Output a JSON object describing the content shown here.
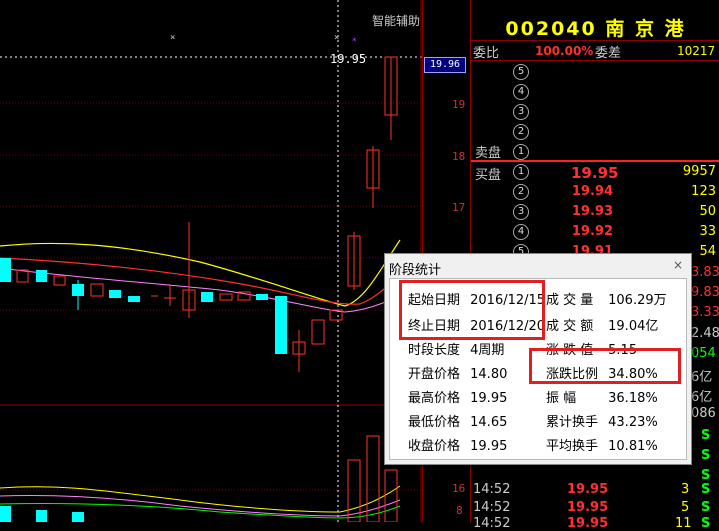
{
  "header": {
    "smart_assist": "智能辅助",
    "highlight_price": "19.95",
    "price_tag": "19.96"
  },
  "axis": {
    "labels": [
      "19",
      "18",
      "17"
    ],
    "low_labels": [
      "16",
      "8"
    ]
  },
  "panel": {
    "code": "002040",
    "name": "南 京 港",
    "weibi_label": "委比",
    "weibi_value": "100.00%",
    "weicha_label": "委差",
    "weicha_value": "10217",
    "sell_label": "卖盘",
    "buy_label": "买盘",
    "sell_levels": [
      "5",
      "4",
      "3",
      "2",
      "1"
    ],
    "buy_levels": [
      {
        "n": "1",
        "price": "19.95",
        "vol": "9957"
      },
      {
        "n": "2",
        "price": "19.94",
        "vol": "123"
      },
      {
        "n": "3",
        "price": "19.93",
        "vol": "50"
      },
      {
        "n": "4",
        "price": "19.92",
        "vol": "33"
      },
      {
        "n": "5",
        "price": "19.91",
        "vol": "54"
      }
    ],
    "side_values": [
      "3.83",
      "9.83",
      "3.33",
      "2.48",
      "054",
      "6亿",
      "6亿",
      "086"
    ],
    "trades": [
      {
        "time": "14:52",
        "price": "19.95",
        "vol": "3",
        "bs": "S"
      },
      {
        "time": "14:52",
        "price": "19.95",
        "vol": "5",
        "bs": "S"
      },
      {
        "time": "14:52",
        "price": "19.95",
        "vol": "11",
        "bs": "S"
      }
    ],
    "trade_s_col": [
      "S",
      "S",
      "S",
      "S"
    ]
  },
  "dialog": {
    "title": "阶段统计",
    "close": "×",
    "left": [
      {
        "k": "起始日期",
        "v": "2016/12/15"
      },
      {
        "k": "终止日期",
        "v": "2016/12/20"
      },
      {
        "k": "时段长度",
        "v": "4周期"
      },
      {
        "k": "开盘价格",
        "v": "14.80"
      },
      {
        "k": "最高价格",
        "v": "19.95"
      },
      {
        "k": "最低价格",
        "v": "14.65"
      },
      {
        "k": "收盘价格",
        "v": "19.95"
      }
    ],
    "right": [
      {
        "k": "成 交 量",
        "v": "106.29万"
      },
      {
        "k": "成 交 额",
        "v": "19.04亿"
      },
      {
        "k": "涨 跌 值",
        "v": "5.15"
      },
      {
        "k": "涨跌比例",
        "v": "34.80%"
      },
      {
        "k": "振 幅",
        "v": "36.18%"
      },
      {
        "k": "累计换手",
        "v": "43.23%"
      },
      {
        "k": "平均换手",
        "v": "10.81%"
      }
    ]
  },
  "colors": {
    "up": "#ff3030",
    "down": "#00ffff",
    "accent": "#ffff00",
    "highlight_box": "#e02020"
  }
}
